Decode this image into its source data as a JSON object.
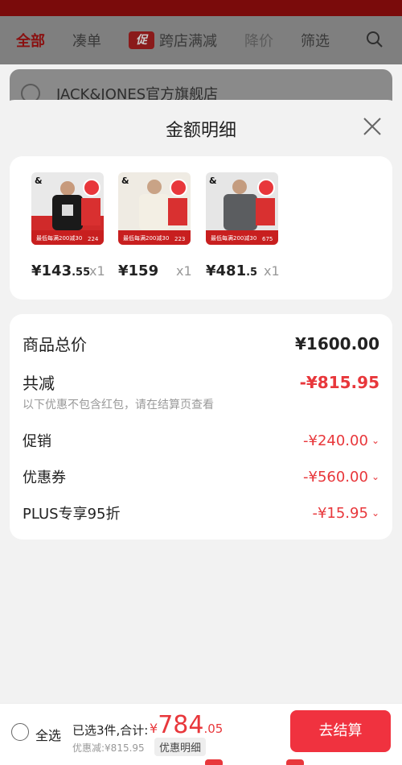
{
  "top_tabs": [
    "全部",
    "凑单",
    "跨店满减",
    "降价",
    "筛选"
  ],
  "promo_badge": "促",
  "store_name": "JACK&JONES官方旗舰店",
  "sheet": {
    "title": "金额明细"
  },
  "products": [
    {
      "price_int": "¥143",
      "price_dec": ".55",
      "qty": "x1"
    },
    {
      "price_int": "¥159",
      "price_dec": "",
      "qty": "x1"
    },
    {
      "price_int": "¥481",
      "price_dec": ".5",
      "qty": "x1"
    }
  ],
  "summary": {
    "total_label": "商品总价",
    "total_value": "¥1600.00",
    "discount_label": "共减",
    "discount_value": "-¥815.95",
    "note": "以下优惠不包含红包，请在结算页查看",
    "items": [
      {
        "label": "促销",
        "value": "-¥240.00"
      },
      {
        "label": "优惠券",
        "value": "-¥560.00"
      },
      {
        "label": "PLUS专享95折",
        "value": "-¥15.95"
      }
    ]
  },
  "bottom": {
    "select_all": "全选",
    "selected_text": "已选3件,合计:",
    "total_currency": "¥",
    "total_int": "784",
    "total_dec": ".05",
    "saving": "优惠减:¥815.95",
    "detail_chip": "优惠明细",
    "checkout": "去结算"
  },
  "colors": {
    "accent": "#e8373b",
    "checkout": "#f0323f"
  }
}
